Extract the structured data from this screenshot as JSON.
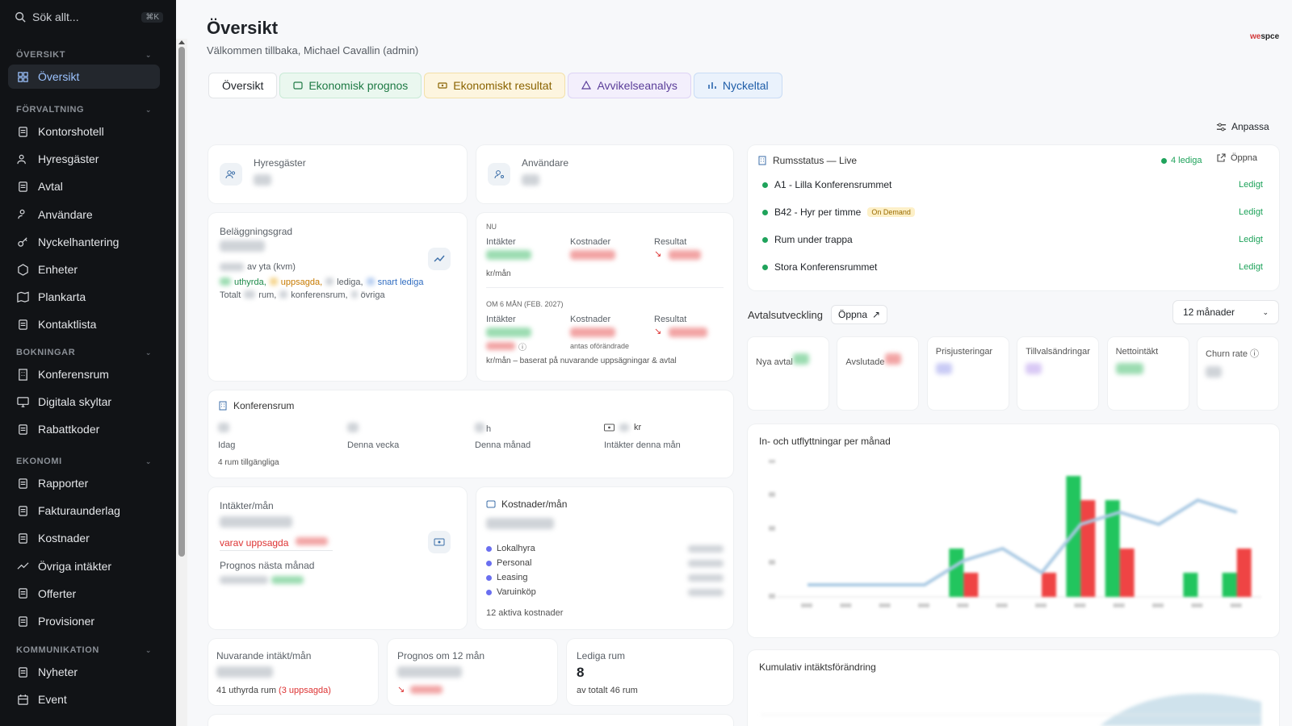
{
  "search": {
    "placeholder": "Sök allt...",
    "shortcut": "⌘K"
  },
  "sidebar": {
    "sections": [
      {
        "title": "ÖVERSIKT",
        "items": [
          "Översikt"
        ]
      },
      {
        "title": "FÖRVALTNING",
        "items": [
          "Kontorshotell",
          "Hyresgäster",
          "Avtal",
          "Användare",
          "Nyckelhantering",
          "Enheter",
          "Plankarta",
          "Kontaktlista"
        ]
      },
      {
        "title": "BOKNINGAR",
        "items": [
          "Konferensrum",
          "Digitala skyltar",
          "Rabattkoder"
        ]
      },
      {
        "title": "EKONOMI",
        "items": [
          "Rapporter",
          "Fakturaunderlag",
          "Kostnader",
          "Övriga intäkter",
          "Offerter",
          "Provisioner"
        ]
      },
      {
        "title": "KOMMUNIKATION",
        "items": [
          "Nyheter",
          "Event"
        ]
      }
    ]
  },
  "header": {
    "title": "Översikt",
    "welcome": "Välkommen tillbaka, Michael Cavallin (admin)",
    "logo_a": "we",
    "logo_b": "spce"
  },
  "tabs": [
    "Översikt",
    "Ekonomisk prognos",
    "Ekonomiskt resultat",
    "Avvikelseanalys",
    "Nyckeltal"
  ],
  "customize": "Anpassa",
  "cards": {
    "tenants": "Hyresgäster",
    "users": "Användare",
    "occupancy": {
      "title": "Beläggningsgrad",
      "by_area": "av yta (kvm)",
      "rented": "uthyrda,",
      "terminated": "uppsagda,",
      "vacant": "lediga,",
      "soon_vacant": "snart lediga",
      "total": "Totalt",
      "rooms": "rum,",
      "conf": "konferensrum,",
      "other": "övriga"
    },
    "finance": {
      "now": "NU",
      "income": "Intäkter",
      "costs": "Kostnader",
      "result": "Resultat",
      "per_month": "kr/mån",
      "in6": "OM 6 MÅN (FEB. 2027)",
      "unchanged": "antas oförändrade",
      "note": "kr/mån – baserat på nuvarande uppsägningar & avtal"
    },
    "conference": {
      "title": "Konferensrum",
      "today": "Idag",
      "week": "Denna vecka",
      "month": "Denna månad",
      "income": "Intäkter denna mån",
      "available": "4 rum tillgängliga",
      "h": "h",
      "kr": "kr"
    },
    "income": {
      "title": "Intäkter/mån",
      "terminated": "varav uppsagda",
      "forecast": "Prognos nästa månad"
    },
    "costs": {
      "title": "Kostnader/mån",
      "items": [
        "Lokalhyra",
        "Personal",
        "Leasing",
        "Varuinköp"
      ],
      "active": "12 aktiva kostnader"
    },
    "current": {
      "title": "Nuvarande intäkt/mån",
      "rented": "41 uthyrda rum",
      "terminated": "(3 uppsagda)"
    },
    "forecast12": {
      "title": "Prognos om 12 mån"
    },
    "vacant": {
      "title": "Lediga rum",
      "value": "8",
      "total": "av totalt 46 rum"
    }
  },
  "roomstatus": {
    "title": "Rumsstatus — Live",
    "vacant_count": "4 lediga",
    "open": "Öppna",
    "rooms": [
      {
        "name": "A1 - Lilla Konferensrummet",
        "status": "Ledigt"
      },
      {
        "name": "B42 - Hyr per timme",
        "status": "Ledigt",
        "badge": "On Demand"
      },
      {
        "name": "Rum under trappa",
        "status": "Ledigt"
      },
      {
        "name": "Stora Konferensrummet",
        "status": "Ledigt"
      }
    ]
  },
  "agreements": {
    "title": "Avtalsutveckling",
    "open": "Öppna",
    "period": "12 månader",
    "kpis": [
      "Nya avtal",
      "Avslutade",
      "Prisjusteringar",
      "Tillvalsändringar",
      "Nettointäkt",
      "Churn rate"
    ]
  },
  "charts": {
    "moves_title": "In- och utflyttningar per månad",
    "cumulative_title": "Kumulativ intäktsförändring"
  },
  "chart_data": {
    "type": "bar",
    "series": [
      {
        "values": [
          0,
          0,
          0,
          0,
          2,
          0,
          0,
          5,
          4,
          0,
          1,
          1
        ],
        "color": "#22c55e"
      },
      {
        "values": [
          0,
          0,
          0,
          0,
          1,
          0,
          1,
          4,
          2,
          0,
          0,
          2
        ],
        "color": "#ef4444"
      }
    ],
    "line": [
      0.5,
      0.5,
      0.5,
      0.5,
      1.5,
      2,
      1,
      3,
      3.5,
      3,
      4,
      3.5
    ]
  }
}
